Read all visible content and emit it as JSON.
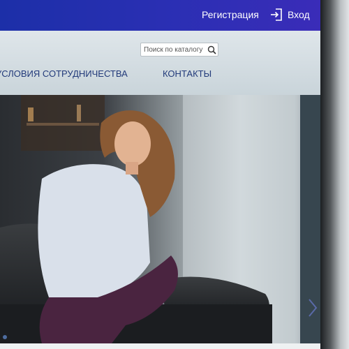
{
  "topbar": {
    "register_label": "Регистрация",
    "login_label": "Вход",
    "login_icon": "sign-in-icon"
  },
  "search": {
    "placeholder": "Поиск по каталогу",
    "icon": "search-icon"
  },
  "nav": {
    "items": [
      {
        "label": "УСЛОВИЯ СОТРУДНИЧЕСТВА"
      },
      {
        "label": "КОНТАКТЫ"
      }
    ]
  },
  "hero": {
    "image": "woman-seated-on-leather-armchair-photo",
    "next_icon": "chevron-right-icon"
  },
  "colors": {
    "topbar": "#2b2fb4",
    "nav_text": "#223a7a",
    "header_bg": "#d3dce1"
  }
}
